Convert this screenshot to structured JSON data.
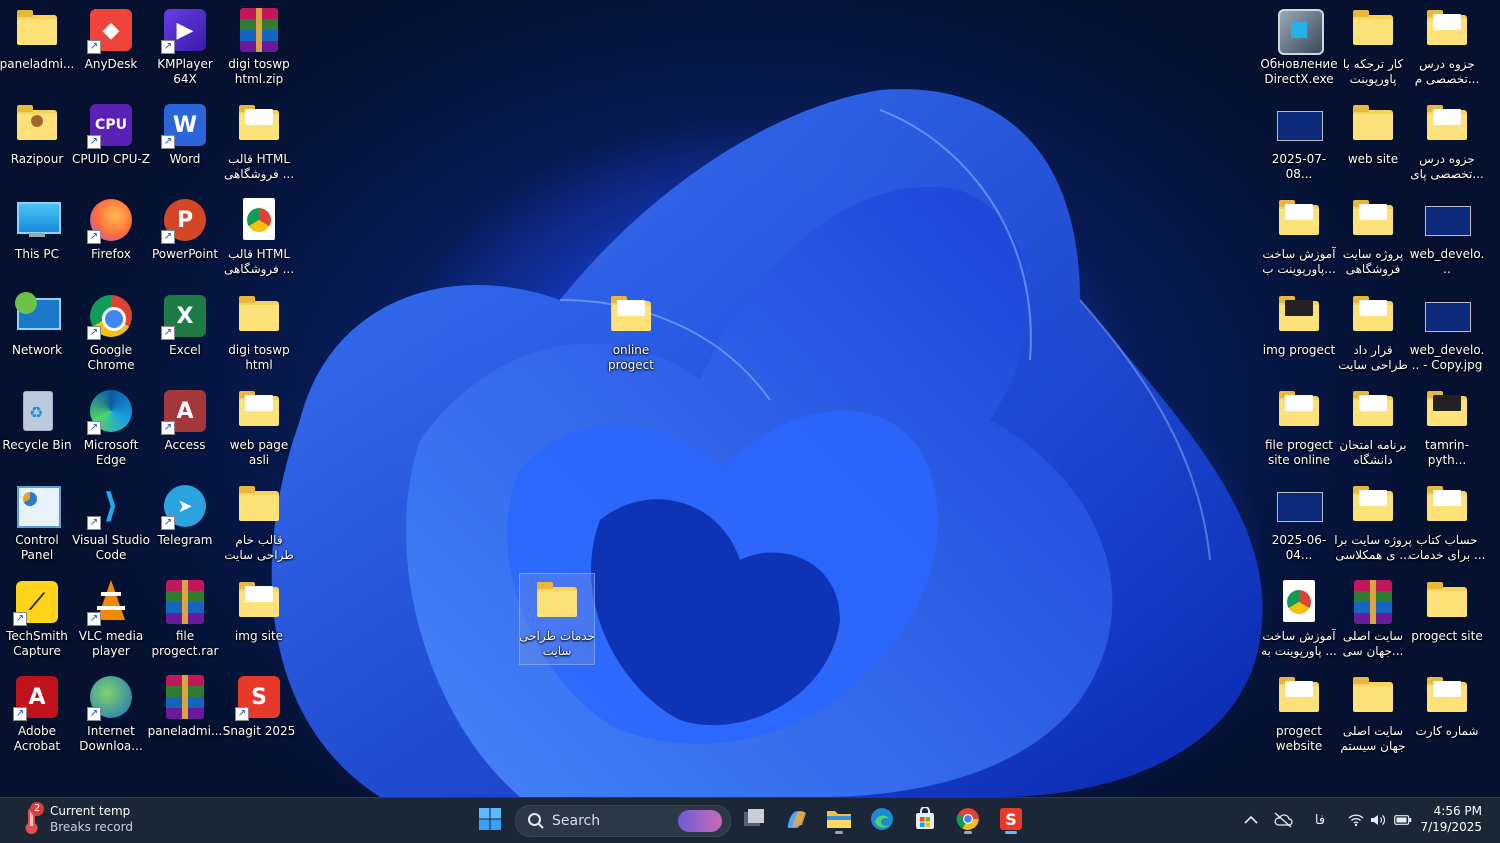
{
  "desktop": {
    "icons": [
      {
        "name": "paneladmin-folder",
        "label": "paneladmi...",
        "kind": "folder"
      },
      {
        "name": "anydesk",
        "label": "AnyDesk",
        "kind": "anydesk"
      },
      {
        "name": "kmplayer",
        "label": "KMPlayer 64X",
        "kind": "kmplayer"
      },
      {
        "name": "digi-toswp-html-zip",
        "label": "digi toswp html.zip",
        "kind": "rar"
      },
      {
        "name": "razipour",
        "label": "Razipour",
        "kind": "user-folder"
      },
      {
        "name": "cpuid-cpu-z",
        "label": "CPUID CPU-Z",
        "kind": "cpuz"
      },
      {
        "name": "word",
        "label": "Word",
        "kind": "word"
      },
      {
        "name": "html-template-1",
        "label": "قالب HTML فروشگاهی ...",
        "kind": "folder-paper"
      },
      {
        "name": "this-pc",
        "label": "This PC",
        "kind": "thispc"
      },
      {
        "name": "firefox",
        "label": "Firefox",
        "kind": "firefox"
      },
      {
        "name": "powerpoint",
        "label": "PowerPoint",
        "kind": "powerpoint"
      },
      {
        "name": "html-template-2",
        "label": "قالب HTML فروشگاهی ...",
        "kind": "chrome-doc"
      },
      {
        "name": "network",
        "label": "Network",
        "kind": "network"
      },
      {
        "name": "google-chrome",
        "label": "Google Chrome",
        "kind": "chrome"
      },
      {
        "name": "excel",
        "label": "Excel",
        "kind": "excel"
      },
      {
        "name": "digi-toswp-html",
        "label": "digi toswp html",
        "kind": "folder"
      },
      {
        "name": "recycle-bin",
        "label": "Recycle Bin",
        "kind": "recycle"
      },
      {
        "name": "microsoft-edge",
        "label": "Microsoft Edge",
        "kind": "edge"
      },
      {
        "name": "access",
        "label": "Access",
        "kind": "access"
      },
      {
        "name": "web-page-asli",
        "label": "web page asli",
        "kind": "folder-paper"
      },
      {
        "name": "control-panel",
        "label": "Control Panel",
        "kind": "controlpanel"
      },
      {
        "name": "visual-studio-code",
        "label": "Visual Studio Code",
        "kind": "vscode"
      },
      {
        "name": "telegram",
        "label": "Telegram",
        "kind": "telegram"
      },
      {
        "name": "raw-site-template",
        "label": "قالب خام طراحی سایت",
        "kind": "folder"
      },
      {
        "name": "techsmith-capture",
        "label": "TechSmith Capture",
        "kind": "techsmith"
      },
      {
        "name": "vlc",
        "label": "VLC media player",
        "kind": "vlc"
      },
      {
        "name": "file-progect-rar",
        "label": "file progect.rar",
        "kind": "rar"
      },
      {
        "name": "img-site",
        "label": "img site",
        "kind": "folder-paper"
      },
      {
        "name": "adobe-acrobat",
        "label": "Adobe Acrobat",
        "kind": "acrobat"
      },
      {
        "name": "internet-download",
        "label": "Internet Downloa...",
        "kind": "idm"
      },
      {
        "name": "paneladmin-rar",
        "label": "paneladmi...",
        "kind": "rar"
      },
      {
        "name": "snagit",
        "label": "Snagit 2025",
        "kind": "snagit"
      },
      {
        "name": "online-progect",
        "label": "online progect",
        "kind": "folder-paper"
      },
      {
        "name": "site-design-services",
        "label": "خدمات طراحی سایت",
        "kind": "folder",
        "selected": true
      },
      {
        "name": "directx-update",
        "label": "Обновление DirectX.exe",
        "kind": "directx"
      },
      {
        "name": "work-with-powerpoint",
        "label": "کار ترجکه با پاورپوینت",
        "kind": "folder"
      },
      {
        "name": "course-notes-1",
        "label": "جزوه درس تخصصی م...",
        "kind": "folder-paper"
      },
      {
        "name": "screenshot-2025-07-08",
        "label": "2025-07-08...",
        "kind": "image"
      },
      {
        "name": "web-site",
        "label": "web site",
        "kind": "folder"
      },
      {
        "name": "course-notes-2",
        "label": "جزوه درس تخصصی پای...",
        "kind": "folder-paper"
      },
      {
        "name": "ppt-tutorial-folder",
        "label": "آموزش ساخت پاورپوینت ب...",
        "kind": "folder-paper"
      },
      {
        "name": "shop-site-project",
        "label": "پروژه سایت فروشگاهی",
        "kind": "folder-paper"
      },
      {
        "name": "web-develop-jpg",
        "label": "web_develo...",
        "kind": "image"
      },
      {
        "name": "img-progect",
        "label": "img progect",
        "kind": "folder-dark"
      },
      {
        "name": "site-design-contract",
        "label": "قرار داد طراحی سایت",
        "kind": "folder-paper"
      },
      {
        "name": "web-develop-copy",
        "label": "web_develo... - Copy.jpg",
        "kind": "image"
      },
      {
        "name": "file-progect-site-online",
        "label": "file progect site online",
        "kind": "folder-paper"
      },
      {
        "name": "university-exam-schedule",
        "label": "برنامه امتحان دانشگاه",
        "kind": "folder-paper"
      },
      {
        "name": "tamrin-python",
        "label": "tamrin-pyth...",
        "kind": "folder-dark"
      },
      {
        "name": "video-2025-06-04",
        "label": "2025-06-04...",
        "kind": "image"
      },
      {
        "name": "classmate-site-project",
        "label": "پروژه سایت برا ی همکلاسی ...",
        "kind": "folder-paper"
      },
      {
        "name": "book-account",
        "label": "حساب کتاب برای خدمات ...",
        "kind": "folder-paper"
      },
      {
        "name": "ppt-tutorial-chrome",
        "label": "آموزش ساخت پاورپوینت به ...",
        "kind": "chrome-doc"
      },
      {
        "name": "jahan-cc-main-site",
        "label": "سایت اصلی جهان سی...",
        "kind": "rar"
      },
      {
        "name": "progect-site",
        "label": "progect site",
        "kind": "folder"
      },
      {
        "name": "progect-website",
        "label": "progect website",
        "kind": "folder-paper"
      },
      {
        "name": "jahan-system-main-site",
        "label": "سایت اصلی جهان سیستم",
        "kind": "folder"
      },
      {
        "name": "card-number",
        "label": "شماره کارت",
        "kind": "folder-paper"
      }
    ]
  },
  "taskbar": {
    "weather": {
      "badge": "2",
      "line1": "Current temp",
      "line2": "Breaks record"
    },
    "search_placeholder": "Search",
    "apps": [
      {
        "name": "start-button",
        "icon": "windows-icon"
      },
      {
        "name": "task-view-button",
        "icon": "task-view-icon"
      },
      {
        "name": "copilot-button",
        "icon": "copilot-icon"
      },
      {
        "name": "file-explorer-button",
        "icon": "folder-icon",
        "state": "running"
      },
      {
        "name": "edge-button",
        "icon": "edge-icon"
      },
      {
        "name": "store-button",
        "icon": "store-icon"
      },
      {
        "name": "chrome-button",
        "icon": "chrome-icon",
        "state": "running"
      },
      {
        "name": "snagit-button",
        "icon": "snagit-icon",
        "state": "active"
      }
    ],
    "tray": {
      "lang": "فا"
    },
    "clock": {
      "time": "4:56 PM",
      "date": "7/19/2025"
    }
  },
  "colors": {
    "taskbar": "#1b2636",
    "accent": "#6fb3ff",
    "folder": "#f8d35c"
  }
}
